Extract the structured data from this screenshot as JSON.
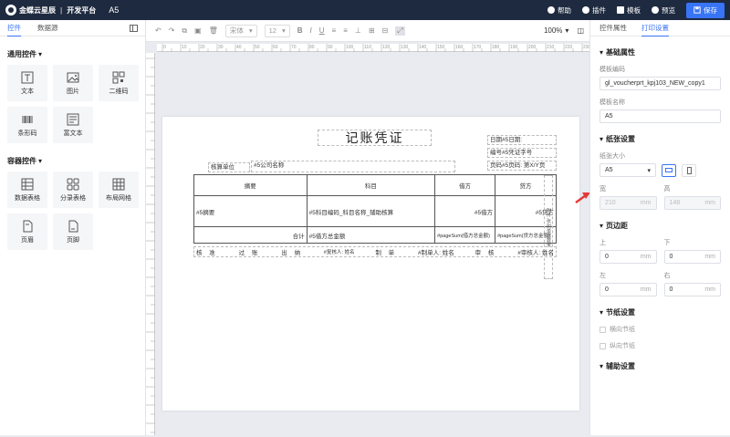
{
  "app": {
    "logo_text": "金蝶云星辰",
    "platform": "开发平台",
    "doc_name": "A5"
  },
  "top_actions": {
    "help": "帮助",
    "plugin": "插件",
    "template": "模板",
    "preview": "预览",
    "save": "保存"
  },
  "left_panel": {
    "tabs": [
      "控件",
      "数据源"
    ],
    "general_title": "通用控件",
    "general_items": [
      {
        "label": "文本",
        "icon": "text-icon"
      },
      {
        "label": "图片",
        "icon": "image-icon"
      },
      {
        "label": "二维码",
        "icon": "qrcode-icon"
      },
      {
        "label": "条形码",
        "icon": "barcode-icon"
      },
      {
        "label": "富文本",
        "icon": "richtext-icon"
      }
    ],
    "container_title": "容器控件",
    "container_items": [
      {
        "label": "数据表格",
        "icon": "table-icon"
      },
      {
        "label": "分录表格",
        "icon": "entry-table-icon"
      },
      {
        "label": "布局网格",
        "icon": "grid-icon"
      },
      {
        "label": "页眉",
        "icon": "header-icon"
      },
      {
        "label": "页脚",
        "icon": "footer-icon"
      }
    ]
  },
  "toolbar": {
    "font": "宋体",
    "font_size": "12",
    "zoom": "100%"
  },
  "voucher": {
    "title": "记账凭证",
    "date": "日期#5日期:",
    "voucher_no": "编号#5凭证字号",
    "page_no": "页码#5页码: 第X/Y页",
    "unit_label": "核算单位",
    "unit_value": "#5公司名称",
    "headers": [
      "摘要",
      "科目",
      "借方",
      "贷方"
    ],
    "row": [
      "#5摘要",
      "#5科目编码_科目名称_辅助核算",
      "#5借方",
      "#5贷方"
    ],
    "total_label": "合计",
    "total_value": "#5借方总金额",
    "total_debit": "#pageSum(借方总金额)",
    "total_credit": "#pageSum(贷方总金额)",
    "signatures": [
      "核 准",
      "过 账",
      "出 纳",
      "#复核人: 姓名",
      "制 单",
      "#制单人: 姓名",
      "审 核",
      "#审核人: 姓名"
    ],
    "side_text": "附件 张 附单据数量"
  },
  "right_panel": {
    "tabs": [
      "控件属性",
      "打印设置"
    ],
    "basic_title": "基础属性",
    "template_code_label": "模板编码",
    "template_code": "gl_voucherprt_kpj103_NEW_copy1",
    "template_name_label": "模板名称",
    "template_name": "A5",
    "paper_title": "纸张设置",
    "paper_size_label": "纸张大小",
    "paper_size": "A5",
    "width_label": "宽",
    "width_value": "210",
    "height_label": "高",
    "height_value": "148",
    "unit": "mm",
    "margin_title": "页边距",
    "top_label": "上",
    "bottom_label": "下",
    "left_label": "左",
    "right_label": "右",
    "margin_values": [
      "0",
      "0",
      "0",
      "0"
    ],
    "section_title": "节纸设置",
    "horizontal": "横向节纸",
    "vertical": "纵向节纸",
    "aux_title": "辅助设置"
  },
  "colors": {
    "topbar": "#1e2a3f",
    "accent": "#3874f6",
    "arrow": "#e53935"
  }
}
